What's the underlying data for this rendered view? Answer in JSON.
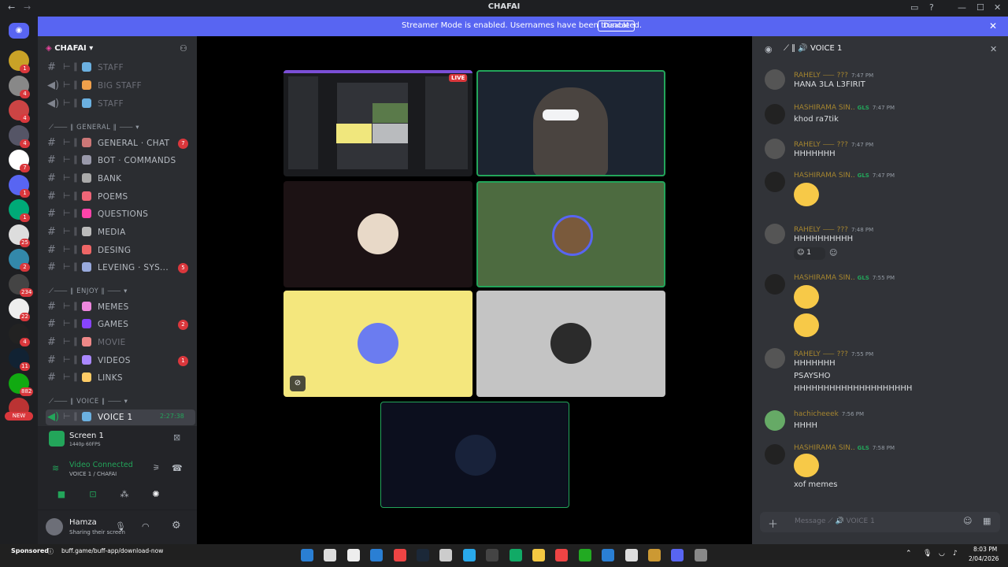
{
  "window": {
    "title": "CHAFAI",
    "min": "—",
    "max": "☐",
    "close": "✕"
  },
  "banner": {
    "message": "Streamer Mode is enabled. Usernames have been truncated.",
    "disable": "Disable"
  },
  "server_badges": [
    "1",
    "4",
    "4",
    "4",
    "7",
    "1",
    "1",
    "25",
    "2",
    "234",
    "22",
    "4",
    "11",
    "882",
    "NEW"
  ],
  "guild": {
    "name": "CHAFAI"
  },
  "channels": [
    {
      "name": "STAFF",
      "muted": true,
      "type": "text",
      "count": ""
    },
    {
      "name": "BIG STAFF",
      "muted": true,
      "type": "voice",
      "count": ""
    },
    {
      "name": "STAFF",
      "muted": true,
      "type": "voice",
      "count": ""
    },
    {
      "name": "GENERAL · CHAT",
      "count": "7"
    },
    {
      "name": "BOT · COMMANDS",
      "count": ""
    },
    {
      "name": "BANK",
      "count": ""
    },
    {
      "name": "POEMS",
      "count": ""
    },
    {
      "name": "QUESTIONS",
      "count": ""
    },
    {
      "name": "MEDIA",
      "count": ""
    },
    {
      "name": "DESING",
      "count": ""
    },
    {
      "name": "LEVEING · SYS...",
      "count": "5"
    },
    {
      "name": "MEMES",
      "count": ""
    },
    {
      "name": "GAMES",
      "count": "2"
    },
    {
      "name": "MOVIE",
      "count": "",
      "muted": true
    },
    {
      "name": "VIDEOS",
      "count": "1"
    },
    {
      "name": "LINKS",
      "count": ""
    },
    {
      "name": "VOICE 1",
      "count": ""
    }
  ],
  "categories": {
    "general": "GENERAL",
    "enjoy": "ENJOY",
    "voice": "VOICE"
  },
  "voice_timer": "2:27:38",
  "screen": {
    "title": "Screen 1",
    "sub": "1440p 60FPS"
  },
  "voice_status": {
    "title": "Video Connected",
    "sub": "VOICE 1 / CHAFAI"
  },
  "user": {
    "name": "Hamza",
    "status": "Sharing their screen"
  },
  "stage": {
    "live": "LIVE"
  },
  "chat": {
    "header": "VOICE 1",
    "placeholder": "Message  ⟋ 🔊 VOICE 1",
    "messages": [
      {
        "name": "RAHELY ⸺ ???",
        "time": "7:47 PM",
        "text": [
          "HANA 3LA L3FIRIT"
        ]
      },
      {
        "name": "HASHIRAMA SIN..",
        "tag": "GLS",
        "time": "7:47 PM",
        "text": [
          "khod ra7tik"
        ]
      },
      {
        "name": "RAHELY ⸺ ???",
        "time": "7:47 PM",
        "text": [
          "HHHHHHH"
        ]
      },
      {
        "name": "HASHIRAMA SIN..",
        "tag": "GLS",
        "time": "7:47 PM",
        "text": []
      },
      {
        "name": "RAHELY ⸺ ???",
        "time": "7:48 PM",
        "text": [
          "HHHHHHHHHH"
        ],
        "reaction": "1"
      },
      {
        "name": "HASHIRAMA SIN..",
        "tag": "GLS",
        "time": "7:55 PM",
        "text": []
      },
      {
        "name": "RAHELY ⸺ ???",
        "time": "7:55 PM",
        "text": [
          "HHHHHHH",
          "PSAYSHO",
          "HHHHHHHHHHHHHHHHHHHH"
        ]
      },
      {
        "name": "hachicheeek",
        "time": "7:56 PM",
        "text": [
          "HHHH"
        ]
      },
      {
        "name": "HASHIRAMA SIN..",
        "tag": "GLS",
        "time": "7:58 PM",
        "text": [
          "xof memes"
        ]
      }
    ]
  },
  "taskbar": {
    "sponsored": "Sponsored",
    "link": "buff.game/buff-app/download-now",
    "time": "8:03 PM",
    "date": "2/04/2026"
  }
}
